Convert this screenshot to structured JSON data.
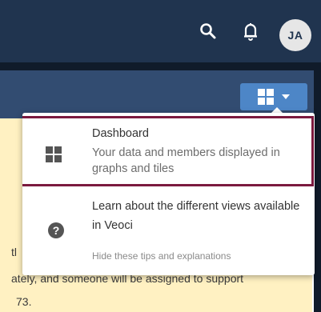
{
  "topbar": {
    "search_icon": "search-icon",
    "bell_icon": "bell-icon",
    "avatar_initials": "JA"
  },
  "view_toggle": {
    "icon": "dashboard-grid-icon",
    "caret": "chevron-down-icon"
  },
  "popover": {
    "dashboard": {
      "title": "Dashboard",
      "description": "Your data and members displayed in graphs and tiles"
    },
    "learn": {
      "text": "Learn about the different views available in Veoci",
      "hide_link": "Hide these tips and explanations"
    }
  },
  "background": {
    "notice_line1": "tl",
    "notice_line2": "ately, and someone will be assigned to support",
    "notice_line3": "73."
  },
  "colors": {
    "topbar": "#20344f",
    "band": "#324c71",
    "toggle": "#4d86c7",
    "highlight_border": "#7b1a3f",
    "notice_bg": "#fff1c2"
  }
}
